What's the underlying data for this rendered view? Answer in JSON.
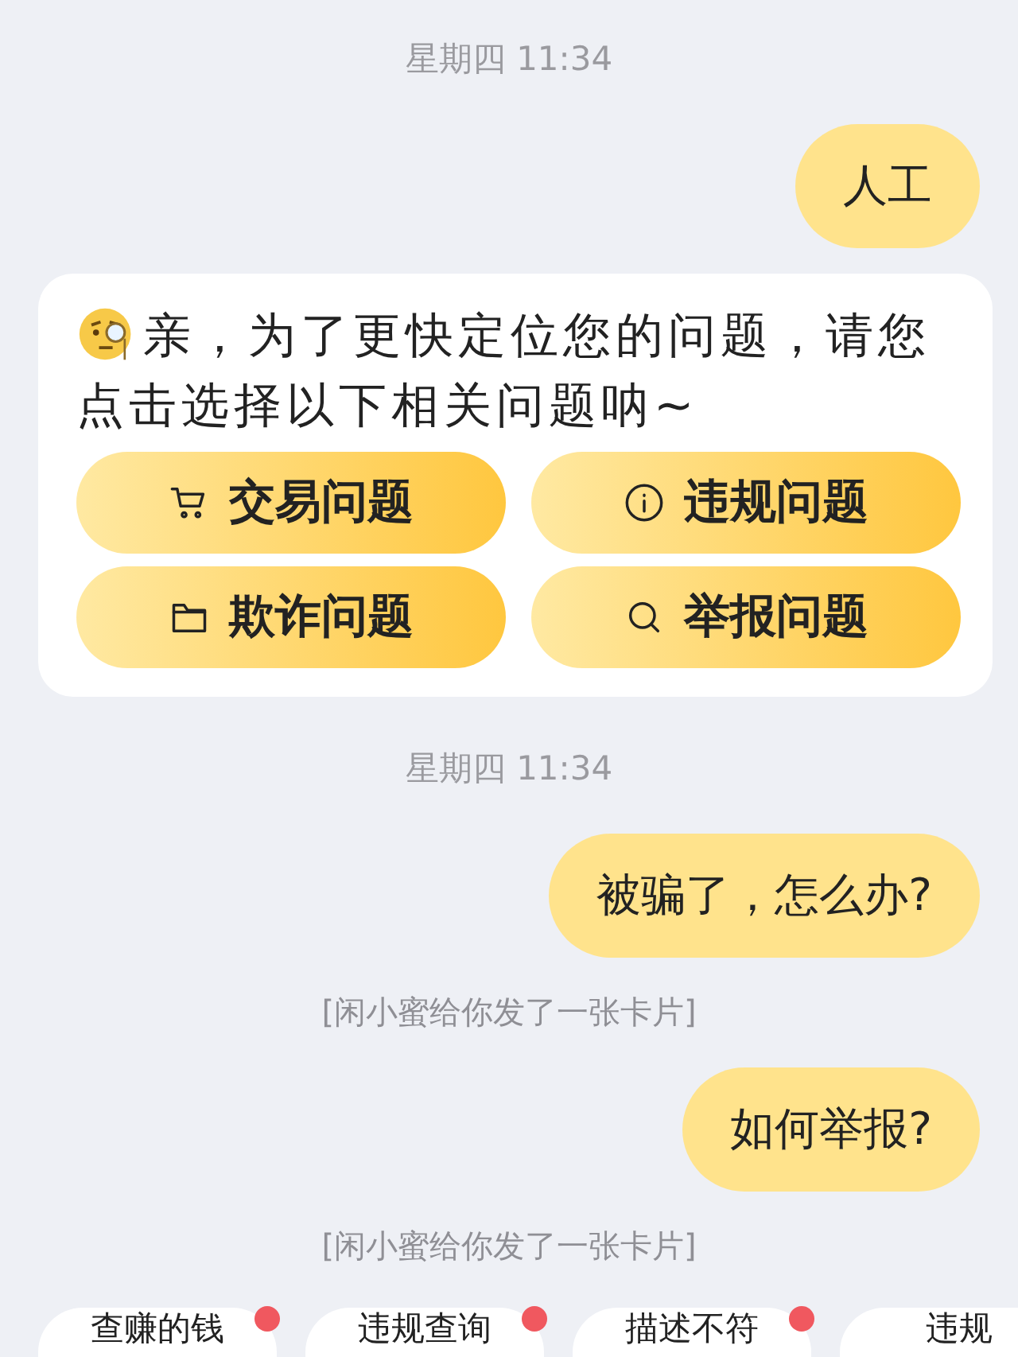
{
  "messages": [
    {
      "kind": "time",
      "text": "星期四 11:34"
    },
    {
      "kind": "outgoing",
      "text": "人工"
    },
    {
      "kind": "card",
      "text": "亲，为了更快定位您的问题，请您点击选择以下相关问题呐~",
      "options": [
        {
          "label": "交易问题"
        },
        {
          "label": "违规问题"
        },
        {
          "label": "欺诈问题"
        },
        {
          "label": "举报问题"
        }
      ]
    },
    {
      "kind": "time",
      "text": "星期四 11:34"
    },
    {
      "kind": "outgoing",
      "text": "被骗了，怎么办?"
    },
    {
      "kind": "notice",
      "text": "[闲小蜜给你发了一张卡片]"
    },
    {
      "kind": "outgoing",
      "text": "如何举报?"
    },
    {
      "kind": "notice",
      "text": "[闲小蜜给你发了一张卡片]"
    }
  ],
  "quick_chips": [
    {
      "label": "查赚的钱",
      "dot": true
    },
    {
      "label": "违规查询",
      "dot": true
    },
    {
      "label": "描述不符",
      "dot": true
    },
    {
      "label": "违规"
    }
  ]
}
